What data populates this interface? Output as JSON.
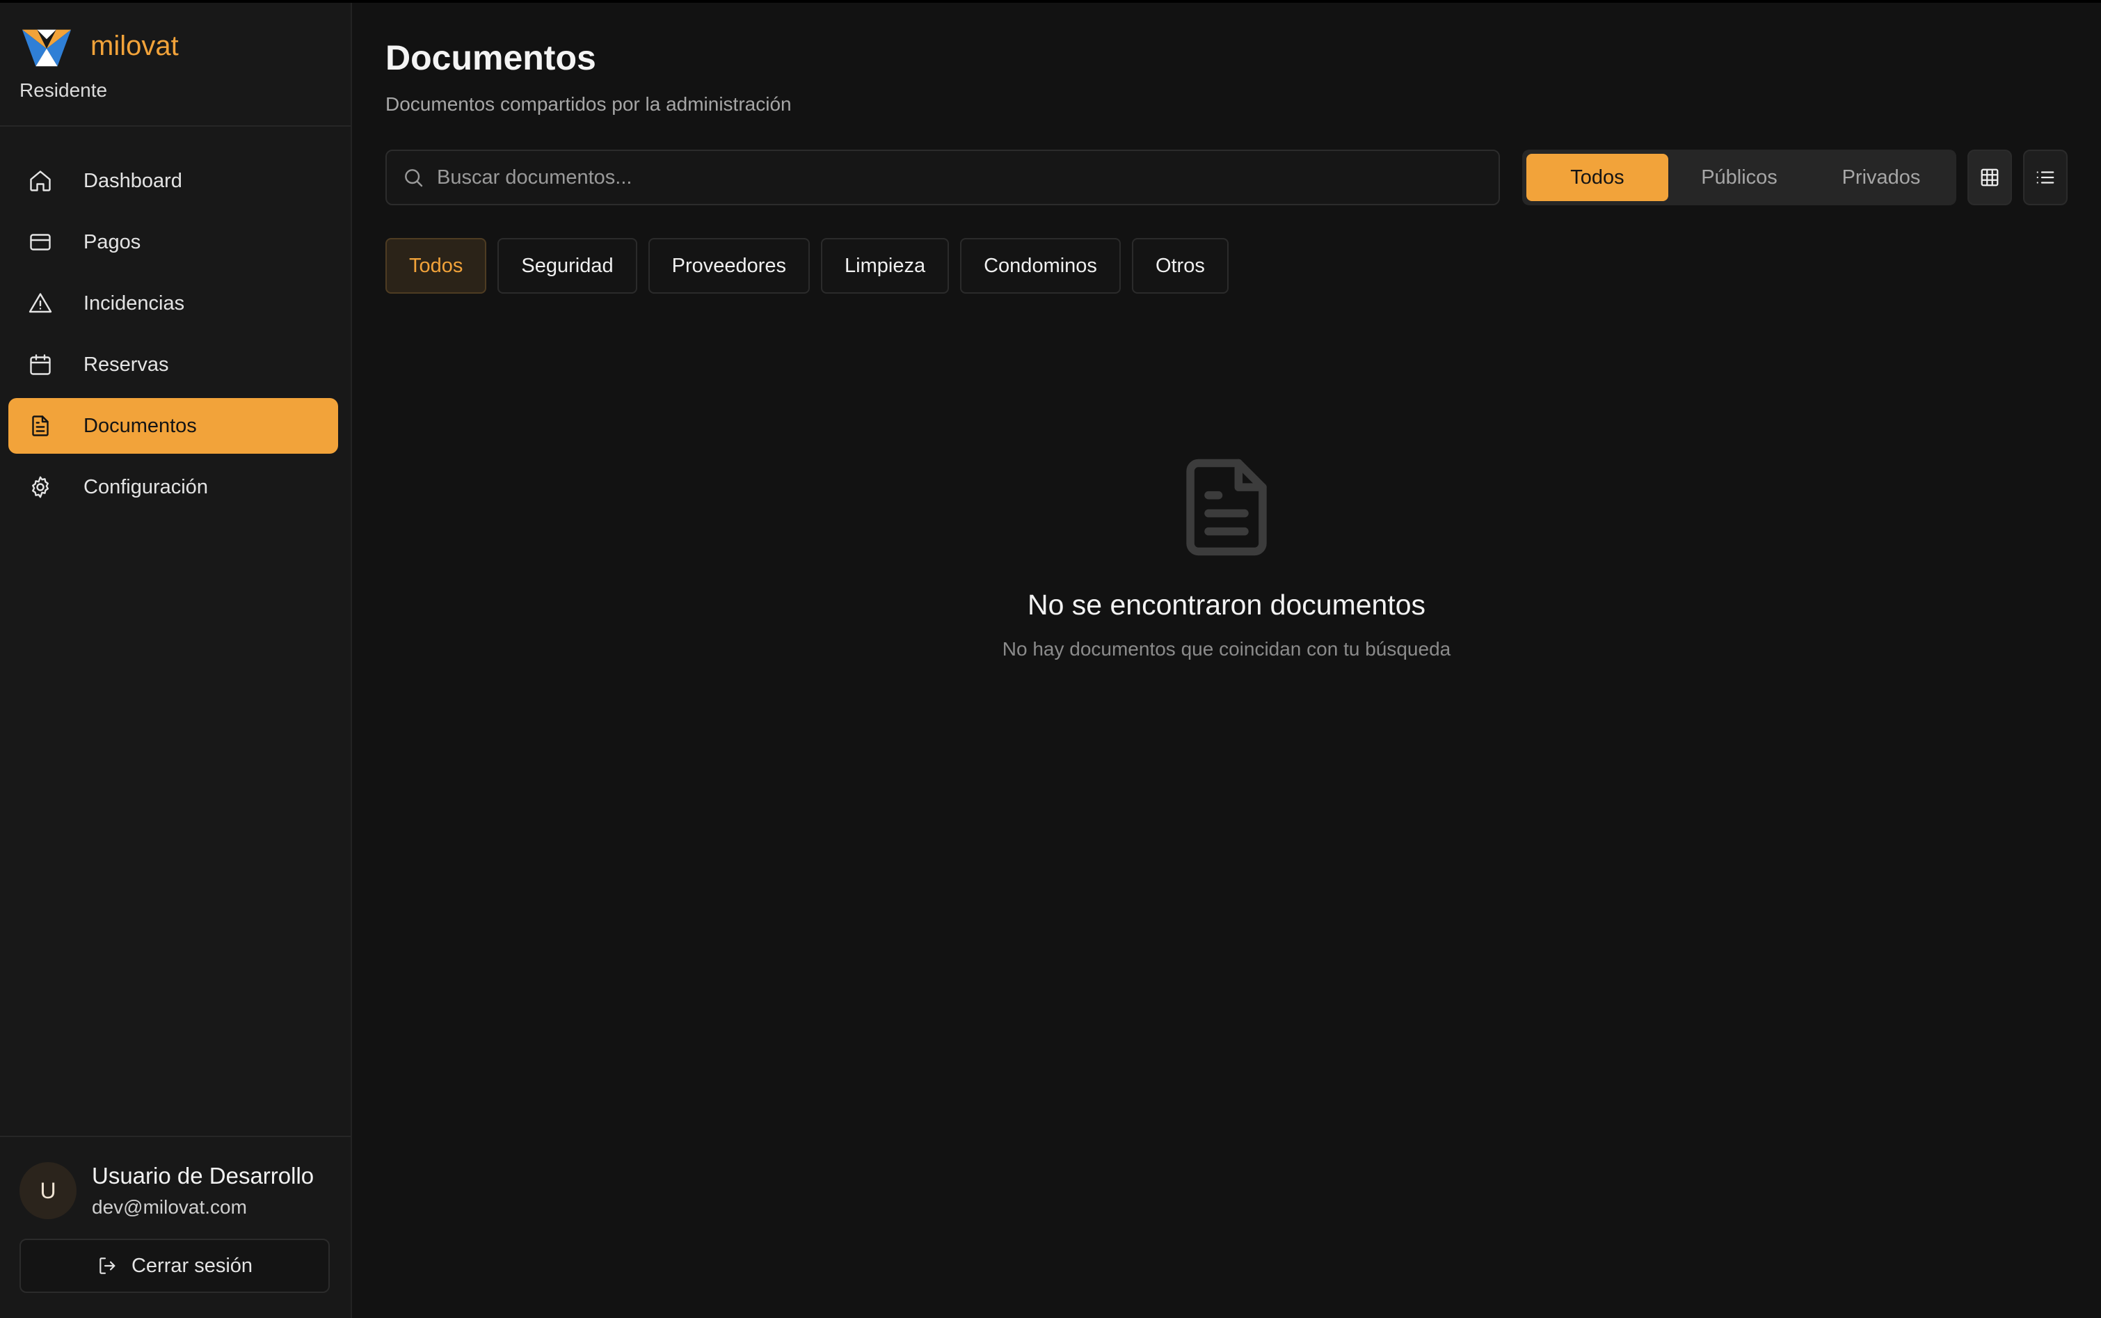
{
  "sidebar": {
    "brand": {
      "name": "milovat",
      "role": "Residente"
    },
    "items": [
      {
        "label": "Dashboard",
        "icon": "home-icon"
      },
      {
        "label": "Pagos",
        "icon": "credit-card-icon"
      },
      {
        "label": "Incidencias",
        "icon": "warning-icon"
      },
      {
        "label": "Reservas",
        "icon": "calendar-icon"
      },
      {
        "label": "Documentos",
        "icon": "document-icon",
        "active": true
      },
      {
        "label": "Configuración",
        "icon": "gear-icon"
      }
    ],
    "user": {
      "initial": "U",
      "name": "Usuario de Desarrollo",
      "email": "dev@milovat.com",
      "logout_label": "Cerrar sesión"
    }
  },
  "main": {
    "title": "Documentos",
    "subtitle": "Documentos compartidos por la administración",
    "search": {
      "placeholder": "Buscar documentos...",
      "value": ""
    },
    "visibility_filter": {
      "options": [
        "Todos",
        "Públicos",
        "Privados"
      ],
      "selected": "Todos"
    },
    "view_modes": {
      "options": [
        "grid-icon",
        "list-icon"
      ],
      "selected": "grid-icon"
    },
    "categories": {
      "options": [
        "Todos",
        "Seguridad",
        "Proveedores",
        "Limpieza",
        "Condominos",
        "Otros"
      ],
      "selected": "Todos"
    },
    "empty_state": {
      "icon": "file-text-icon",
      "title": "No se encontraron documentos",
      "text": "No hay documentos que coincidan con tu búsqueda"
    }
  },
  "colors": {
    "accent": "#f2a33a",
    "background": "#121212",
    "sidebar": "#181818",
    "logo_blue": "#2f7fd6",
    "logo_orange": "#f2a33a"
  }
}
